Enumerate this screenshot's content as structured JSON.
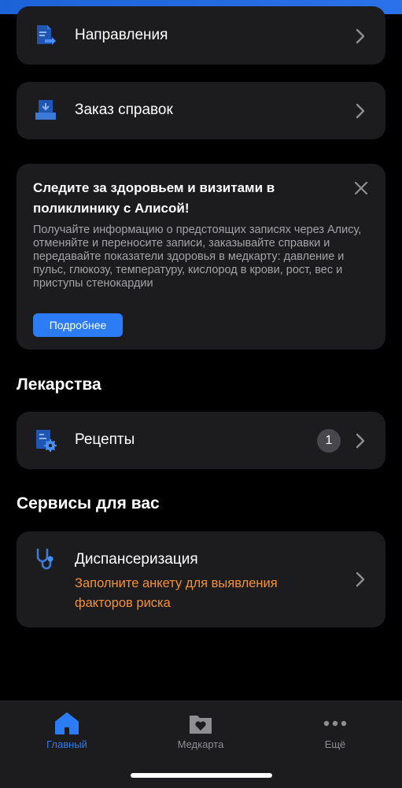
{
  "menu": {
    "directions_label": "Направления",
    "certificates_label": "Заказ справок"
  },
  "banner": {
    "title": "Следите за здоровьем и визитами в поликлинику с Алисой!",
    "body": "Получайте информацию о предстоящих записях через Алису, отменяйте и переносите записи, заказывайте справки и передавайте показатели здоровья в медкарту: давление и пульс, глюкозу, температуру, кислород в крови, рост, вес и приступы стенокардии",
    "button_label": "Подробнее"
  },
  "medicines": {
    "section_title": "Лекарства",
    "prescriptions_label": "Рецепты",
    "prescriptions_count": "1"
  },
  "services": {
    "section_title": "Сервисы для вас",
    "checkup_label": "Диспансеризация",
    "checkup_subtitle": "Заполните анкету для выявления факторов риска"
  },
  "tabbar": {
    "home_label": "Главный",
    "medcard_label": "Медкарта",
    "more_label": "Ещё"
  },
  "colors": {
    "accent": "#2c7cf6",
    "warning": "#f2913a",
    "card": "#1c1c1e",
    "inactive": "#8e8e93"
  }
}
